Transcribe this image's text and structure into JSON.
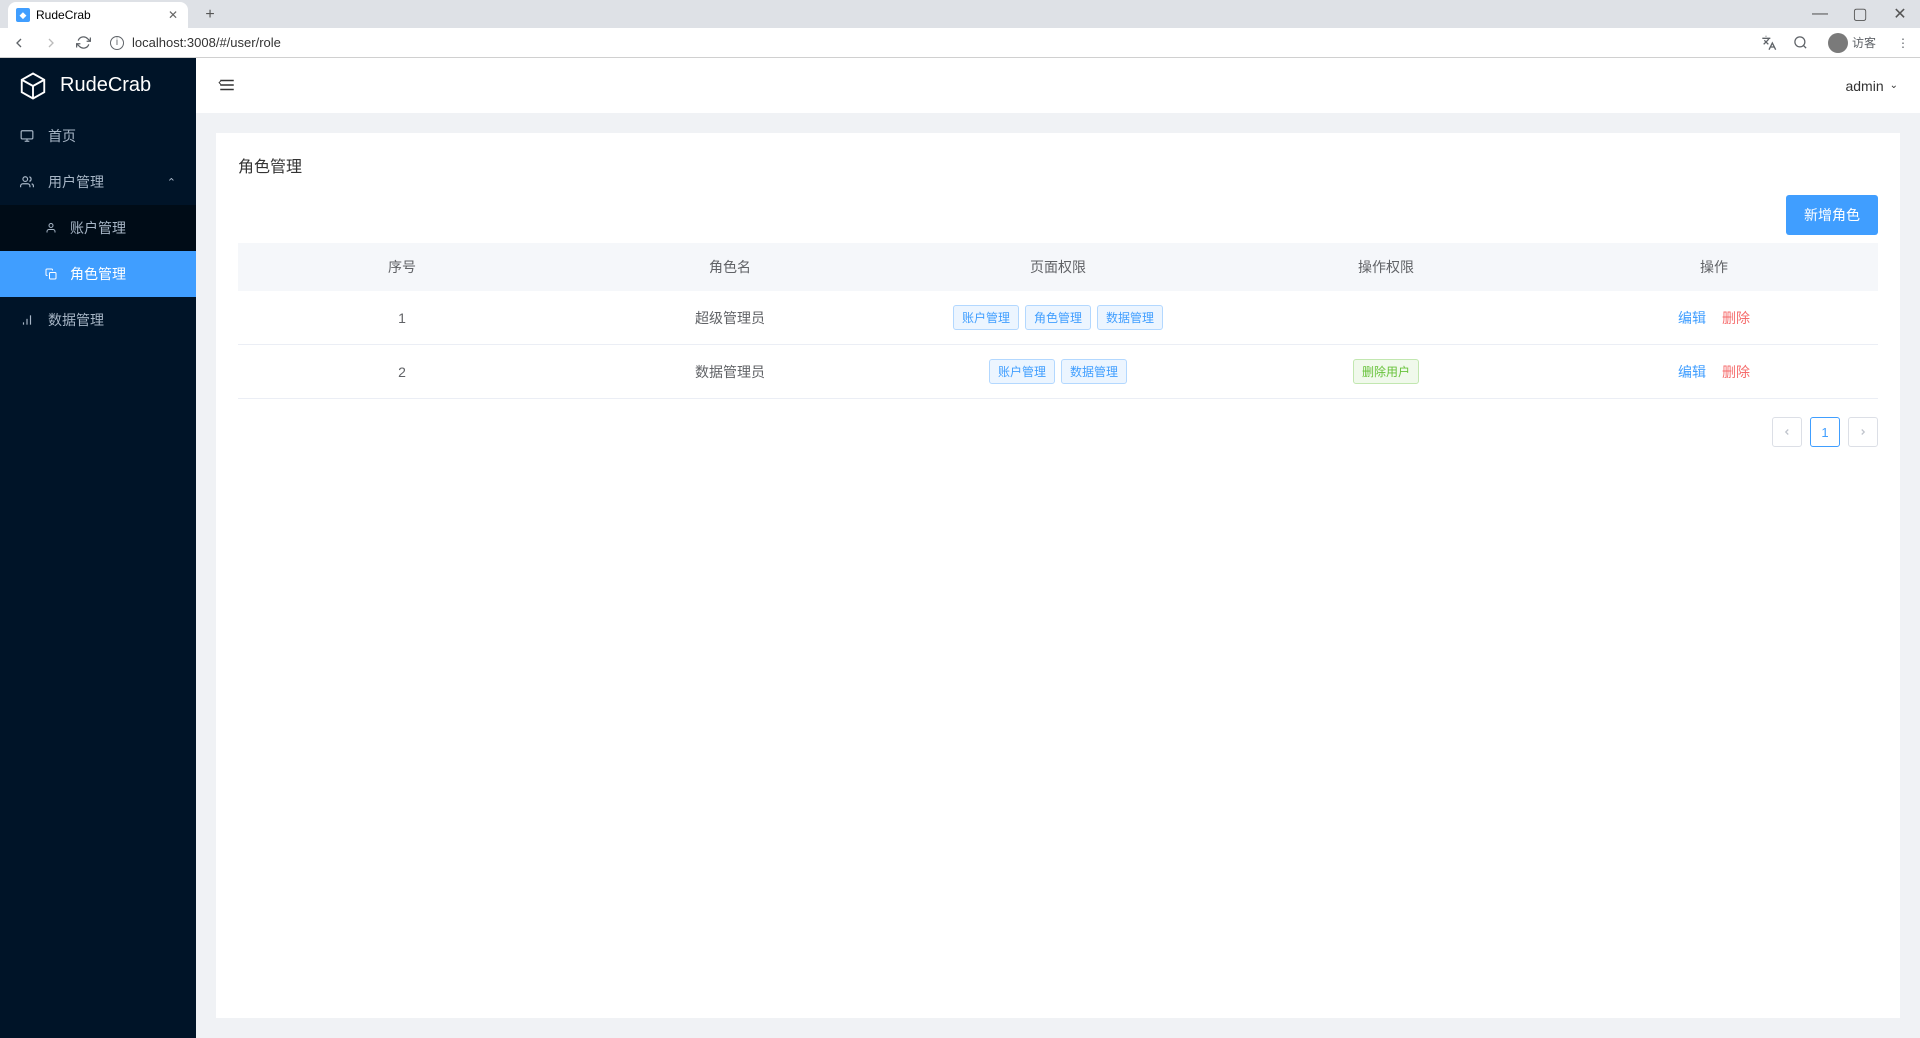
{
  "browser": {
    "tab_title": "RudeCrab",
    "url": "localhost:3008/#/user/role",
    "guest_label": "访客"
  },
  "app": {
    "brand": "RudeCrab"
  },
  "sidebar": {
    "items": [
      {
        "key": "home",
        "label": "首页"
      },
      {
        "key": "user-mgmt",
        "label": "用户管理",
        "children": [
          {
            "key": "account-mgmt",
            "label": "账户管理"
          },
          {
            "key": "role-mgmt",
            "label": "角色管理"
          }
        ]
      },
      {
        "key": "data-mgmt",
        "label": "数据管理"
      }
    ]
  },
  "header": {
    "username": "admin"
  },
  "page": {
    "title": "角色管理",
    "add_button": "新增角色"
  },
  "table": {
    "columns": [
      "序号",
      "角色名",
      "页面权限",
      "操作权限",
      "操作"
    ],
    "rows": [
      {
        "index": "1",
        "name": "超级管理员",
        "page_perms": [
          "账户管理",
          "角色管理",
          "数据管理"
        ],
        "op_perms": [],
        "actions": {
          "edit": "编辑",
          "delete": "删除"
        }
      },
      {
        "index": "2",
        "name": "数据管理员",
        "page_perms": [
          "账户管理",
          "数据管理"
        ],
        "op_perms": [
          "删除用户"
        ],
        "actions": {
          "edit": "编辑",
          "delete": "删除"
        }
      }
    ]
  },
  "pagination": {
    "current": "1"
  }
}
